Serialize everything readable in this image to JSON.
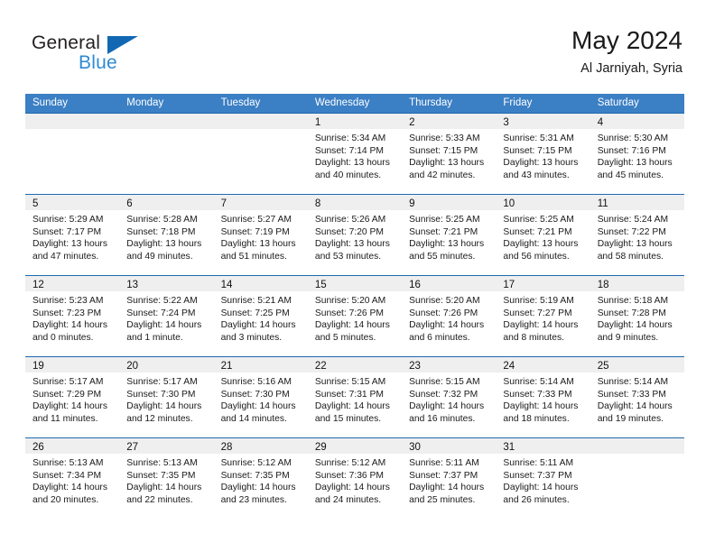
{
  "brand": {
    "name_top": "General",
    "name_bottom": "Blue",
    "accent_color": "#1268b3",
    "accent_color_light": "#2e8ad4"
  },
  "header": {
    "title": "May 2024",
    "subtitle": "Al Jarniyah, Syria"
  },
  "calendar": {
    "header_bg": "#3b7fc4",
    "row_divider_color": "#1f6ab0",
    "day_band_bg": "#efefef",
    "weekday_headers": [
      "Sunday",
      "Monday",
      "Tuesday",
      "Wednesday",
      "Thursday",
      "Friday",
      "Saturday"
    ],
    "weeks": [
      [
        {
          "day": "",
          "sunrise": "",
          "sunset": "",
          "daylight_line1": "",
          "daylight_line2": ""
        },
        {
          "day": "",
          "sunrise": "",
          "sunset": "",
          "daylight_line1": "",
          "daylight_line2": ""
        },
        {
          "day": "",
          "sunrise": "",
          "sunset": "",
          "daylight_line1": "",
          "daylight_line2": ""
        },
        {
          "day": "1",
          "sunrise": "Sunrise: 5:34 AM",
          "sunset": "Sunset: 7:14 PM",
          "daylight_line1": "Daylight: 13 hours",
          "daylight_line2": "and 40 minutes."
        },
        {
          "day": "2",
          "sunrise": "Sunrise: 5:33 AM",
          "sunset": "Sunset: 7:15 PM",
          "daylight_line1": "Daylight: 13 hours",
          "daylight_line2": "and 42 minutes."
        },
        {
          "day": "3",
          "sunrise": "Sunrise: 5:31 AM",
          "sunset": "Sunset: 7:15 PM",
          "daylight_line1": "Daylight: 13 hours",
          "daylight_line2": "and 43 minutes."
        },
        {
          "day": "4",
          "sunrise": "Sunrise: 5:30 AM",
          "sunset": "Sunset: 7:16 PM",
          "daylight_line1": "Daylight: 13 hours",
          "daylight_line2": "and 45 minutes."
        }
      ],
      [
        {
          "day": "5",
          "sunrise": "Sunrise: 5:29 AM",
          "sunset": "Sunset: 7:17 PM",
          "daylight_line1": "Daylight: 13 hours",
          "daylight_line2": "and 47 minutes."
        },
        {
          "day": "6",
          "sunrise": "Sunrise: 5:28 AM",
          "sunset": "Sunset: 7:18 PM",
          "daylight_line1": "Daylight: 13 hours",
          "daylight_line2": "and 49 minutes."
        },
        {
          "day": "7",
          "sunrise": "Sunrise: 5:27 AM",
          "sunset": "Sunset: 7:19 PM",
          "daylight_line1": "Daylight: 13 hours",
          "daylight_line2": "and 51 minutes."
        },
        {
          "day": "8",
          "sunrise": "Sunrise: 5:26 AM",
          "sunset": "Sunset: 7:20 PM",
          "daylight_line1": "Daylight: 13 hours",
          "daylight_line2": "and 53 minutes."
        },
        {
          "day": "9",
          "sunrise": "Sunrise: 5:25 AM",
          "sunset": "Sunset: 7:21 PM",
          "daylight_line1": "Daylight: 13 hours",
          "daylight_line2": "and 55 minutes."
        },
        {
          "day": "10",
          "sunrise": "Sunrise: 5:25 AM",
          "sunset": "Sunset: 7:21 PM",
          "daylight_line1": "Daylight: 13 hours",
          "daylight_line2": "and 56 minutes."
        },
        {
          "day": "11",
          "sunrise": "Sunrise: 5:24 AM",
          "sunset": "Sunset: 7:22 PM",
          "daylight_line1": "Daylight: 13 hours",
          "daylight_line2": "and 58 minutes."
        }
      ],
      [
        {
          "day": "12",
          "sunrise": "Sunrise: 5:23 AM",
          "sunset": "Sunset: 7:23 PM",
          "daylight_line1": "Daylight: 14 hours",
          "daylight_line2": "and 0 minutes."
        },
        {
          "day": "13",
          "sunrise": "Sunrise: 5:22 AM",
          "sunset": "Sunset: 7:24 PM",
          "daylight_line1": "Daylight: 14 hours",
          "daylight_line2": "and 1 minute."
        },
        {
          "day": "14",
          "sunrise": "Sunrise: 5:21 AM",
          "sunset": "Sunset: 7:25 PM",
          "daylight_line1": "Daylight: 14 hours",
          "daylight_line2": "and 3 minutes."
        },
        {
          "day": "15",
          "sunrise": "Sunrise: 5:20 AM",
          "sunset": "Sunset: 7:26 PM",
          "daylight_line1": "Daylight: 14 hours",
          "daylight_line2": "and 5 minutes."
        },
        {
          "day": "16",
          "sunrise": "Sunrise: 5:20 AM",
          "sunset": "Sunset: 7:26 PM",
          "daylight_line1": "Daylight: 14 hours",
          "daylight_line2": "and 6 minutes."
        },
        {
          "day": "17",
          "sunrise": "Sunrise: 5:19 AM",
          "sunset": "Sunset: 7:27 PM",
          "daylight_line1": "Daylight: 14 hours",
          "daylight_line2": "and 8 minutes."
        },
        {
          "day": "18",
          "sunrise": "Sunrise: 5:18 AM",
          "sunset": "Sunset: 7:28 PM",
          "daylight_line1": "Daylight: 14 hours",
          "daylight_line2": "and 9 minutes."
        }
      ],
      [
        {
          "day": "19",
          "sunrise": "Sunrise: 5:17 AM",
          "sunset": "Sunset: 7:29 PM",
          "daylight_line1": "Daylight: 14 hours",
          "daylight_line2": "and 11 minutes."
        },
        {
          "day": "20",
          "sunrise": "Sunrise: 5:17 AM",
          "sunset": "Sunset: 7:30 PM",
          "daylight_line1": "Daylight: 14 hours",
          "daylight_line2": "and 12 minutes."
        },
        {
          "day": "21",
          "sunrise": "Sunrise: 5:16 AM",
          "sunset": "Sunset: 7:30 PM",
          "daylight_line1": "Daylight: 14 hours",
          "daylight_line2": "and 14 minutes."
        },
        {
          "day": "22",
          "sunrise": "Sunrise: 5:15 AM",
          "sunset": "Sunset: 7:31 PM",
          "daylight_line1": "Daylight: 14 hours",
          "daylight_line2": "and 15 minutes."
        },
        {
          "day": "23",
          "sunrise": "Sunrise: 5:15 AM",
          "sunset": "Sunset: 7:32 PM",
          "daylight_line1": "Daylight: 14 hours",
          "daylight_line2": "and 16 minutes."
        },
        {
          "day": "24",
          "sunrise": "Sunrise: 5:14 AM",
          "sunset": "Sunset: 7:33 PM",
          "daylight_line1": "Daylight: 14 hours",
          "daylight_line2": "and 18 minutes."
        },
        {
          "day": "25",
          "sunrise": "Sunrise: 5:14 AM",
          "sunset": "Sunset: 7:33 PM",
          "daylight_line1": "Daylight: 14 hours",
          "daylight_line2": "and 19 minutes."
        }
      ],
      [
        {
          "day": "26",
          "sunrise": "Sunrise: 5:13 AM",
          "sunset": "Sunset: 7:34 PM",
          "daylight_line1": "Daylight: 14 hours",
          "daylight_line2": "and 20 minutes."
        },
        {
          "day": "27",
          "sunrise": "Sunrise: 5:13 AM",
          "sunset": "Sunset: 7:35 PM",
          "daylight_line1": "Daylight: 14 hours",
          "daylight_line2": "and 22 minutes."
        },
        {
          "day": "28",
          "sunrise": "Sunrise: 5:12 AM",
          "sunset": "Sunset: 7:35 PM",
          "daylight_line1": "Daylight: 14 hours",
          "daylight_line2": "and 23 minutes."
        },
        {
          "day": "29",
          "sunrise": "Sunrise: 5:12 AM",
          "sunset": "Sunset: 7:36 PM",
          "daylight_line1": "Daylight: 14 hours",
          "daylight_line2": "and 24 minutes."
        },
        {
          "day": "30",
          "sunrise": "Sunrise: 5:11 AM",
          "sunset": "Sunset: 7:37 PM",
          "daylight_line1": "Daylight: 14 hours",
          "daylight_line2": "and 25 minutes."
        },
        {
          "day": "31",
          "sunrise": "Sunrise: 5:11 AM",
          "sunset": "Sunset: 7:37 PM",
          "daylight_line1": "Daylight: 14 hours",
          "daylight_line2": "and 26 minutes."
        },
        {
          "day": "",
          "sunrise": "",
          "sunset": "",
          "daylight_line1": "",
          "daylight_line2": ""
        }
      ]
    ]
  }
}
